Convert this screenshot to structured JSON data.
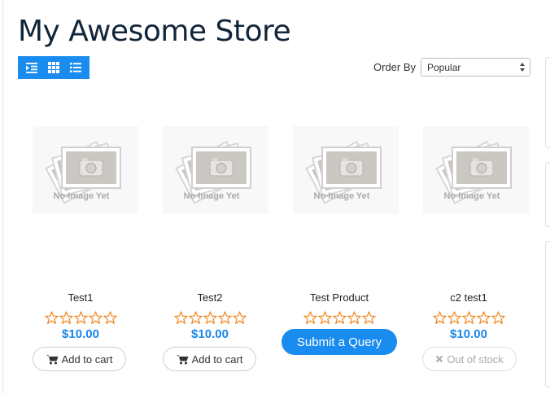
{
  "page": {
    "title": "My Awesome Store"
  },
  "toolbar": {
    "view_buttons": [
      {
        "icon": "indent-list-icon"
      },
      {
        "icon": "grid-icon"
      },
      {
        "icon": "list-icon"
      }
    ],
    "orderby_label": "Order By",
    "orderby_selected": "Popular"
  },
  "image_placeholder_text": "No Image Yet",
  "products": [
    {
      "name": "Test1",
      "rating": 0,
      "price": "$10.00",
      "action": "Add to cart"
    },
    {
      "name": "Test2",
      "rating": 0,
      "price": "$10.00",
      "action": "Add to cart"
    },
    {
      "name": "Test Product",
      "rating": 0,
      "action": "Submit a Query"
    },
    {
      "name": "c2 test1",
      "rating": 0,
      "price": "$10.00",
      "action": "Out of stock"
    }
  ],
  "colors": {
    "accent": "#1a8cf0",
    "price": "#1a85e8",
    "star": "#f08a24",
    "title": "#12263a"
  }
}
